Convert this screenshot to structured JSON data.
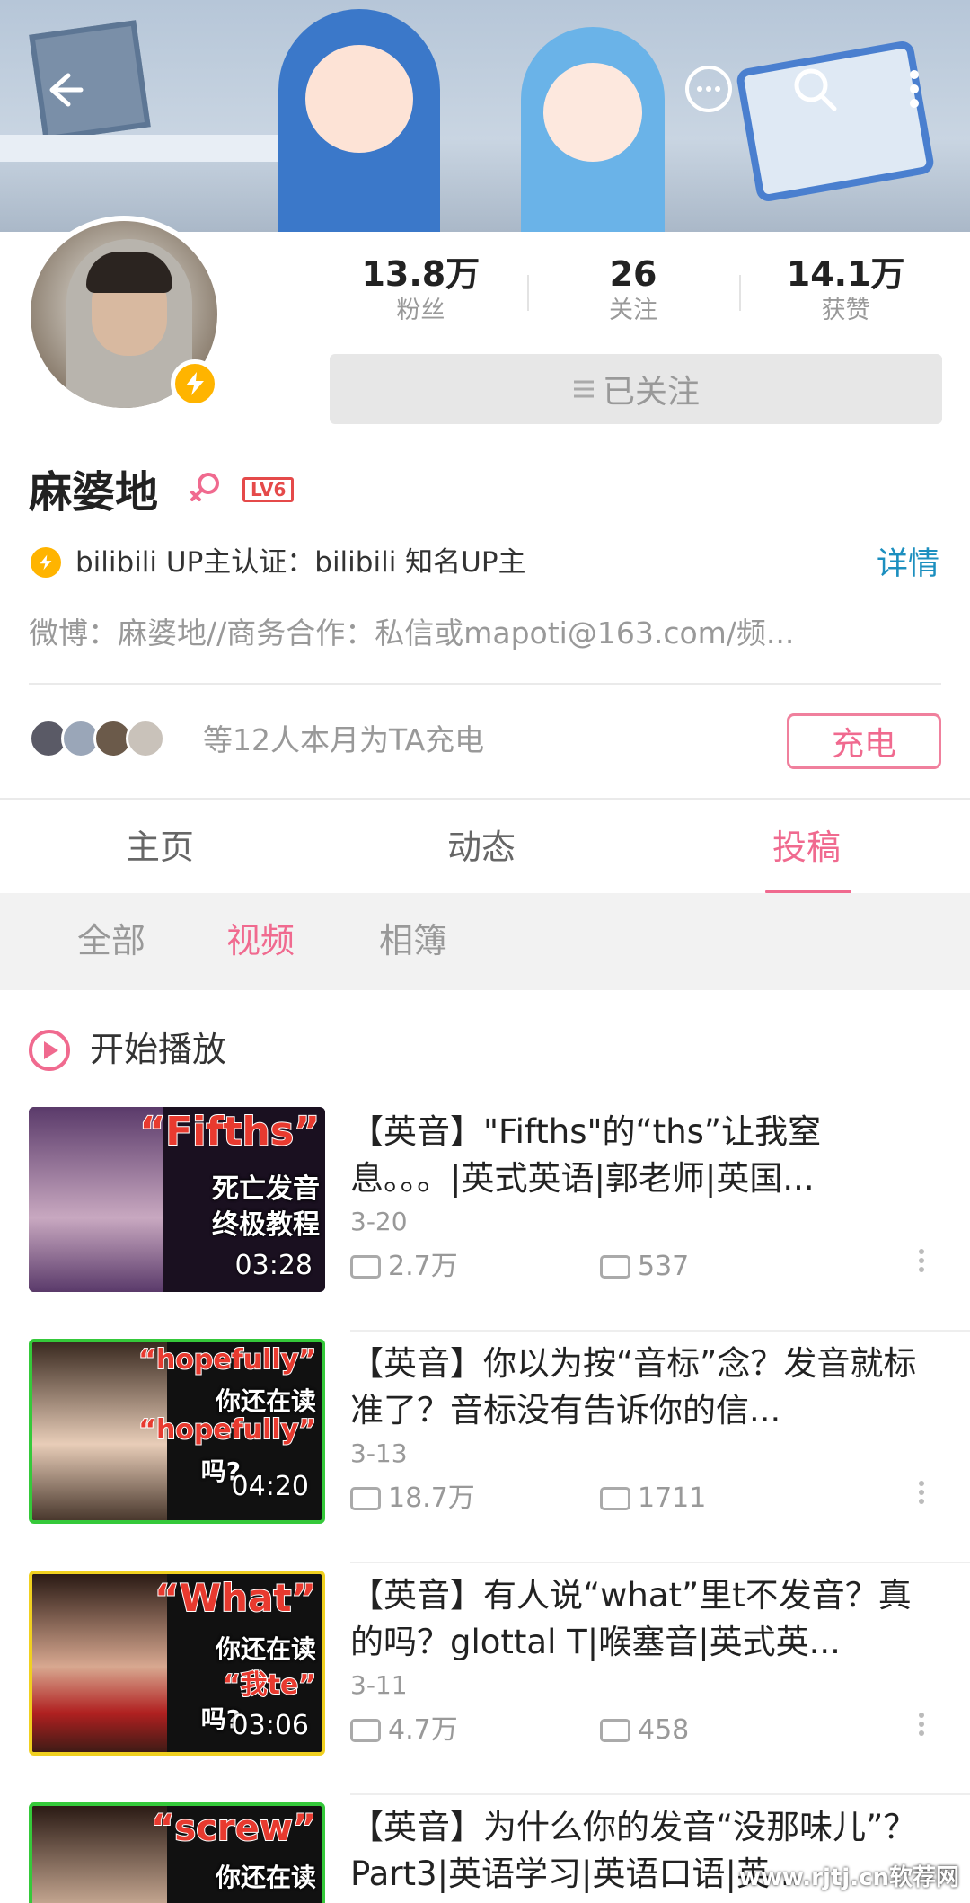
{
  "header": {
    "back_icon": "arrow-left-icon",
    "message_icon": "chat-bubble-icon",
    "search_icon": "search-icon",
    "more_icon": "more-vertical-icon"
  },
  "profile": {
    "name": "麻婆地",
    "level": "LV6",
    "stats": [
      {
        "value": "13.8万",
        "label": "粉丝"
      },
      {
        "value": "26",
        "label": "关注"
      },
      {
        "value": "14.1万",
        "label": "获赞"
      }
    ],
    "follow_label": "已关注",
    "certification": "bilibili UP主认证：bilibili 知名UP主",
    "detail_label": "详情",
    "bio": "微博：麻婆地//商务合作：私信或mapoti@163.com/频..."
  },
  "charge": {
    "text": "等12人本月为TA充电",
    "button": "充电"
  },
  "tabs": [
    "主页",
    "动态",
    "投稿"
  ],
  "subtabs": [
    "全部",
    "视频",
    "相簿"
  ],
  "play_all": "开始播放",
  "videos": [
    {
      "title": "【英音】\"Fifths\"的“ths”让我窒息。。。|英式英语|郭老师|英国...",
      "date": "3-20",
      "plays": "2.7万",
      "danmaku": "537",
      "duration": "03:28",
      "thumb_lines": [
        "“Fifths”",
        "死亡发音",
        "终极教程"
      ]
    },
    {
      "title": "【英音】你以为按“音标”念？发音就标准了？音标没有告诉你的信...",
      "date": "3-13",
      "plays": "18.7万",
      "danmaku": "1711",
      "duration": "04:20",
      "thumb_lines": [
        "“hopefully”",
        "你还在读",
        "“hopefully”",
        "吗?"
      ]
    },
    {
      "title": "【英音】有人说“what”里t不发音？真的吗？glottal T|喉塞音|英式英...",
      "date": "3-11",
      "plays": "4.7万",
      "danmaku": "458",
      "duration": "03:06",
      "thumb_lines": [
        "“What”",
        "你还在读",
        "“我te”",
        "吗?"
      ]
    },
    {
      "title": "【英音】为什么你的发音“没那味儿”？Part3|英语学习|英语口语|英...",
      "date": "",
      "plays": "",
      "danmaku": "",
      "duration": "",
      "thumb_lines": [
        "“screw”",
        "你还在读"
      ]
    }
  ],
  "watermark": "www.rjtj.cn软荐网",
  "colors": {
    "accent": "#f06a8f",
    "link": "#1c8fbf",
    "badge": "#ffb400"
  }
}
